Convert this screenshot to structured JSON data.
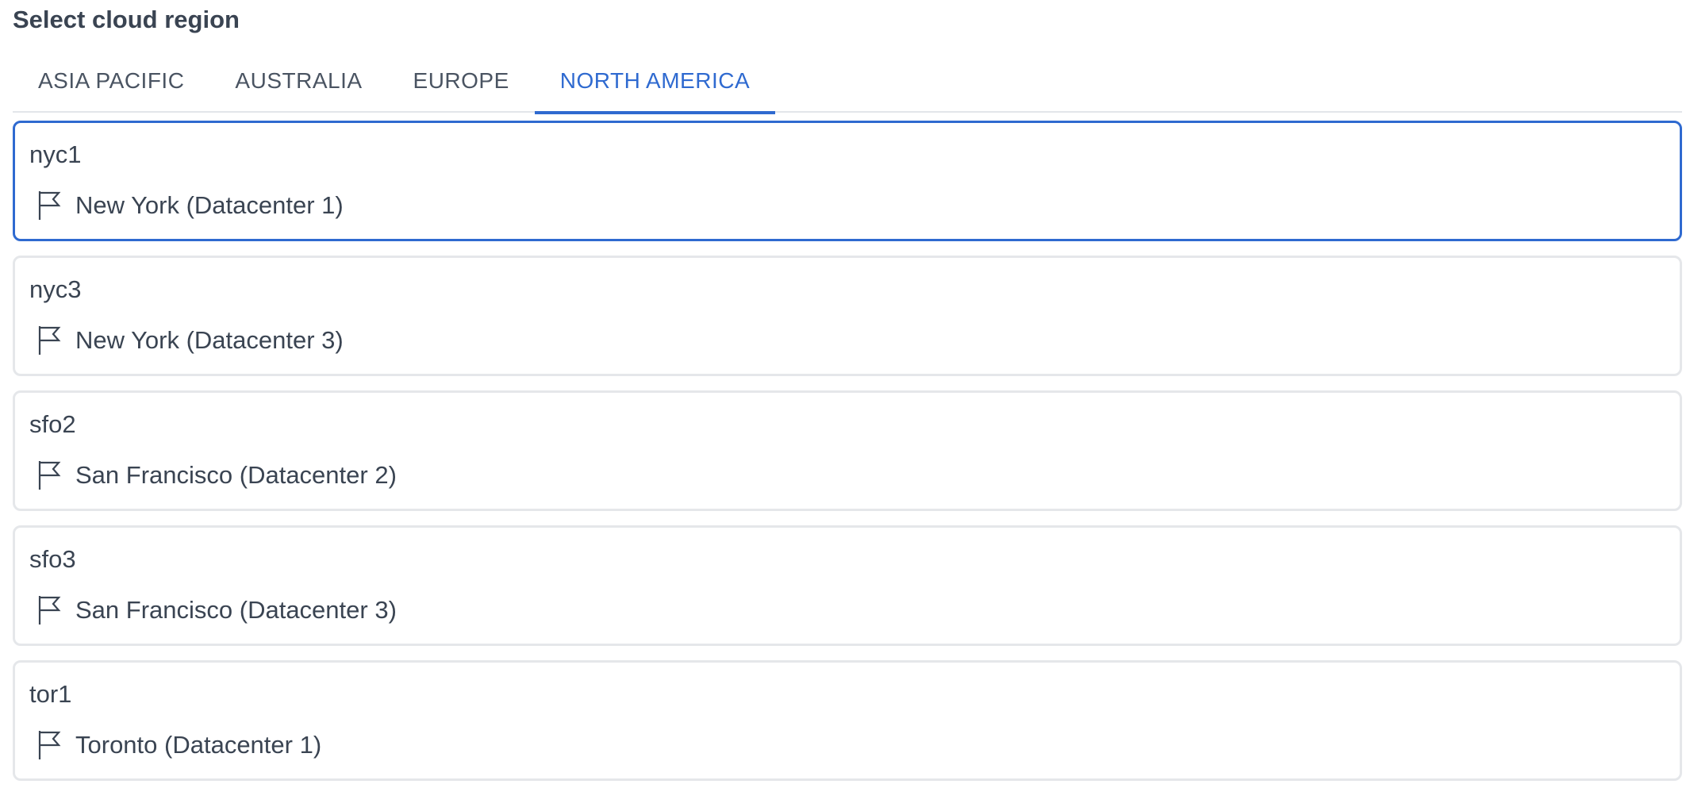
{
  "section": {
    "title": "Select cloud region"
  },
  "tabs": [
    {
      "label": "ASIA PACIFIC",
      "active": false
    },
    {
      "label": "AUSTRALIA",
      "active": false
    },
    {
      "label": "EUROPE",
      "active": false
    },
    {
      "label": "NORTH AMERICA",
      "active": true
    }
  ],
  "regions": [
    {
      "code": "nyc1",
      "name": "New York (Datacenter 1)",
      "selected": true,
      "icon": "flag-icon"
    },
    {
      "code": "nyc3",
      "name": "New York (Datacenter 3)",
      "selected": false,
      "icon": "flag-icon"
    },
    {
      "code": "sfo2",
      "name": "San Francisco (Datacenter 2)",
      "selected": false,
      "icon": "flag-icon"
    },
    {
      "code": "sfo3",
      "name": "San Francisco (Datacenter 3)",
      "selected": false,
      "icon": "flag-icon"
    },
    {
      "code": "tor1",
      "name": "Toronto (Datacenter 1)",
      "selected": false,
      "icon": "flag-icon"
    }
  ],
  "colors": {
    "accent": "#2f6ad0",
    "text": "#3a4452",
    "border": "#e5e7ea"
  }
}
